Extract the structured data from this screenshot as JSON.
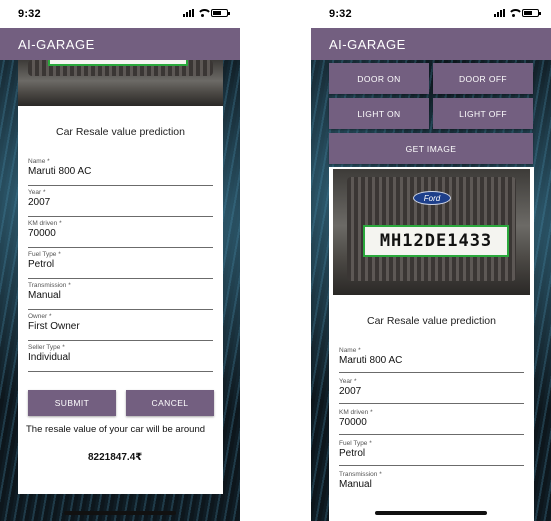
{
  "left": {
    "status": {
      "time": "9:32"
    },
    "appbar": {
      "title": "AI-GARAGE"
    },
    "photo": {
      "plate_text": ""
    },
    "section_title": "Car Resale value prediction",
    "fields": [
      {
        "label": "Name *",
        "value": "Maruti 800 AC"
      },
      {
        "label": "Year *",
        "value": "2007"
      },
      {
        "label": "KM driven *",
        "value": "70000"
      },
      {
        "label": "Fuel Type *",
        "value": "Petrol"
      },
      {
        "label": "Transmission *",
        "value": "Manual"
      },
      {
        "label": "Owner *",
        "value": "First Owner"
      },
      {
        "label": "Seller Type *",
        "value": "Individual"
      }
    ],
    "buttons": {
      "submit": "SUBMIT",
      "cancel": "CANCEL"
    },
    "result": {
      "text": "The resale value of your car will be around",
      "value": "8221847.4₹"
    }
  },
  "right": {
    "status": {
      "time": "9:32"
    },
    "appbar": {
      "title": "AI-GARAGE"
    },
    "controls": {
      "door_on": "DOOR ON",
      "door_off": "DOOR OFF",
      "light_on": "LIGHT ON",
      "light_off": "LIGHT OFF",
      "get_image": "GET IMAGE"
    },
    "photo": {
      "plate_text": "MH12DE1433",
      "emblem": "Ford"
    },
    "section_title": "Car Resale value prediction",
    "fields": [
      {
        "label": "Name *",
        "value": "Maruti 800 AC"
      },
      {
        "label": "Year *",
        "value": "2007"
      },
      {
        "label": "KM driven *",
        "value": "70000"
      },
      {
        "label": "Fuel Type *",
        "value": "Petrol"
      },
      {
        "label": "Transmission *",
        "value": "Manual"
      }
    ]
  },
  "colors": {
    "accent": "#735f80",
    "plate_border": "#2aa83c"
  }
}
